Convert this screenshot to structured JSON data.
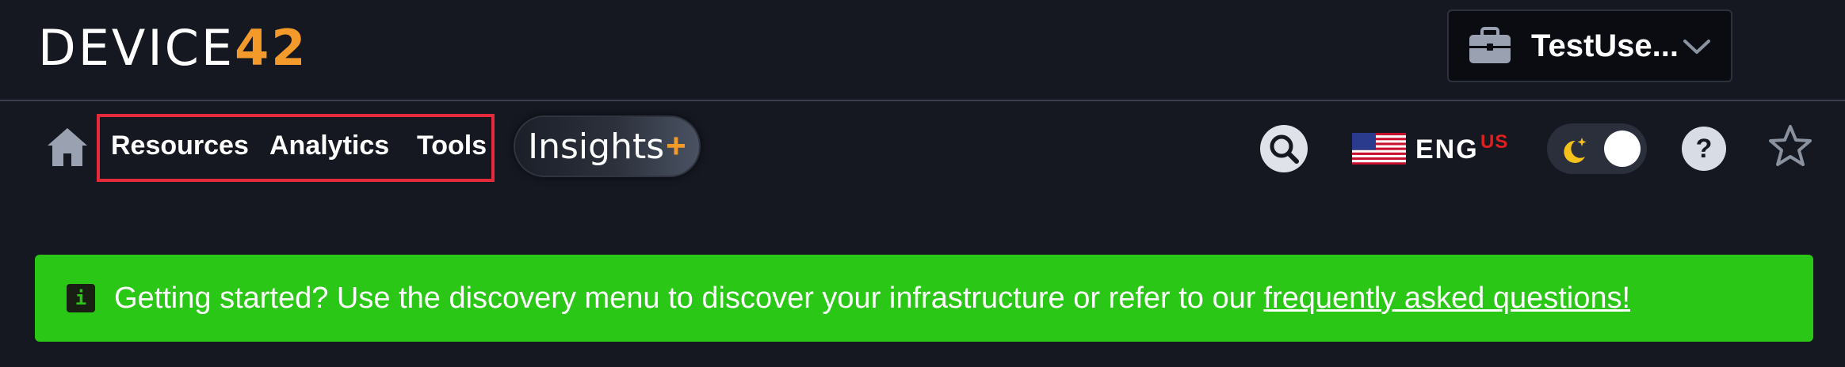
{
  "logo": {
    "part1": "DEVICE",
    "part2": "42"
  },
  "company_select": {
    "name": "TestUse...",
    "icon": "briefcase-icon"
  },
  "nav": {
    "home_icon": "home-icon",
    "links": [
      "Resources",
      "Analytics",
      "Tools"
    ],
    "insights": {
      "label": "Insights",
      "plus": "+"
    }
  },
  "toolbar": {
    "search_icon": "search-icon",
    "language": {
      "code": "ENG",
      "region": "US",
      "flag": "us-flag-icon"
    },
    "theme_toggle": "dark-mode-toggle",
    "help_label": "?",
    "favorite_icon": "star-icon"
  },
  "banner": {
    "message": "Getting started? Use the discovery menu to discover your infrastructure or refer to our",
    "link_text": "frequently asked questions!",
    "info_label": "i"
  },
  "colors": {
    "background": "#151821",
    "accent_orange": "#f39a2b",
    "banner_green": "#2bc716",
    "highlight_red": "#e52a3b"
  }
}
